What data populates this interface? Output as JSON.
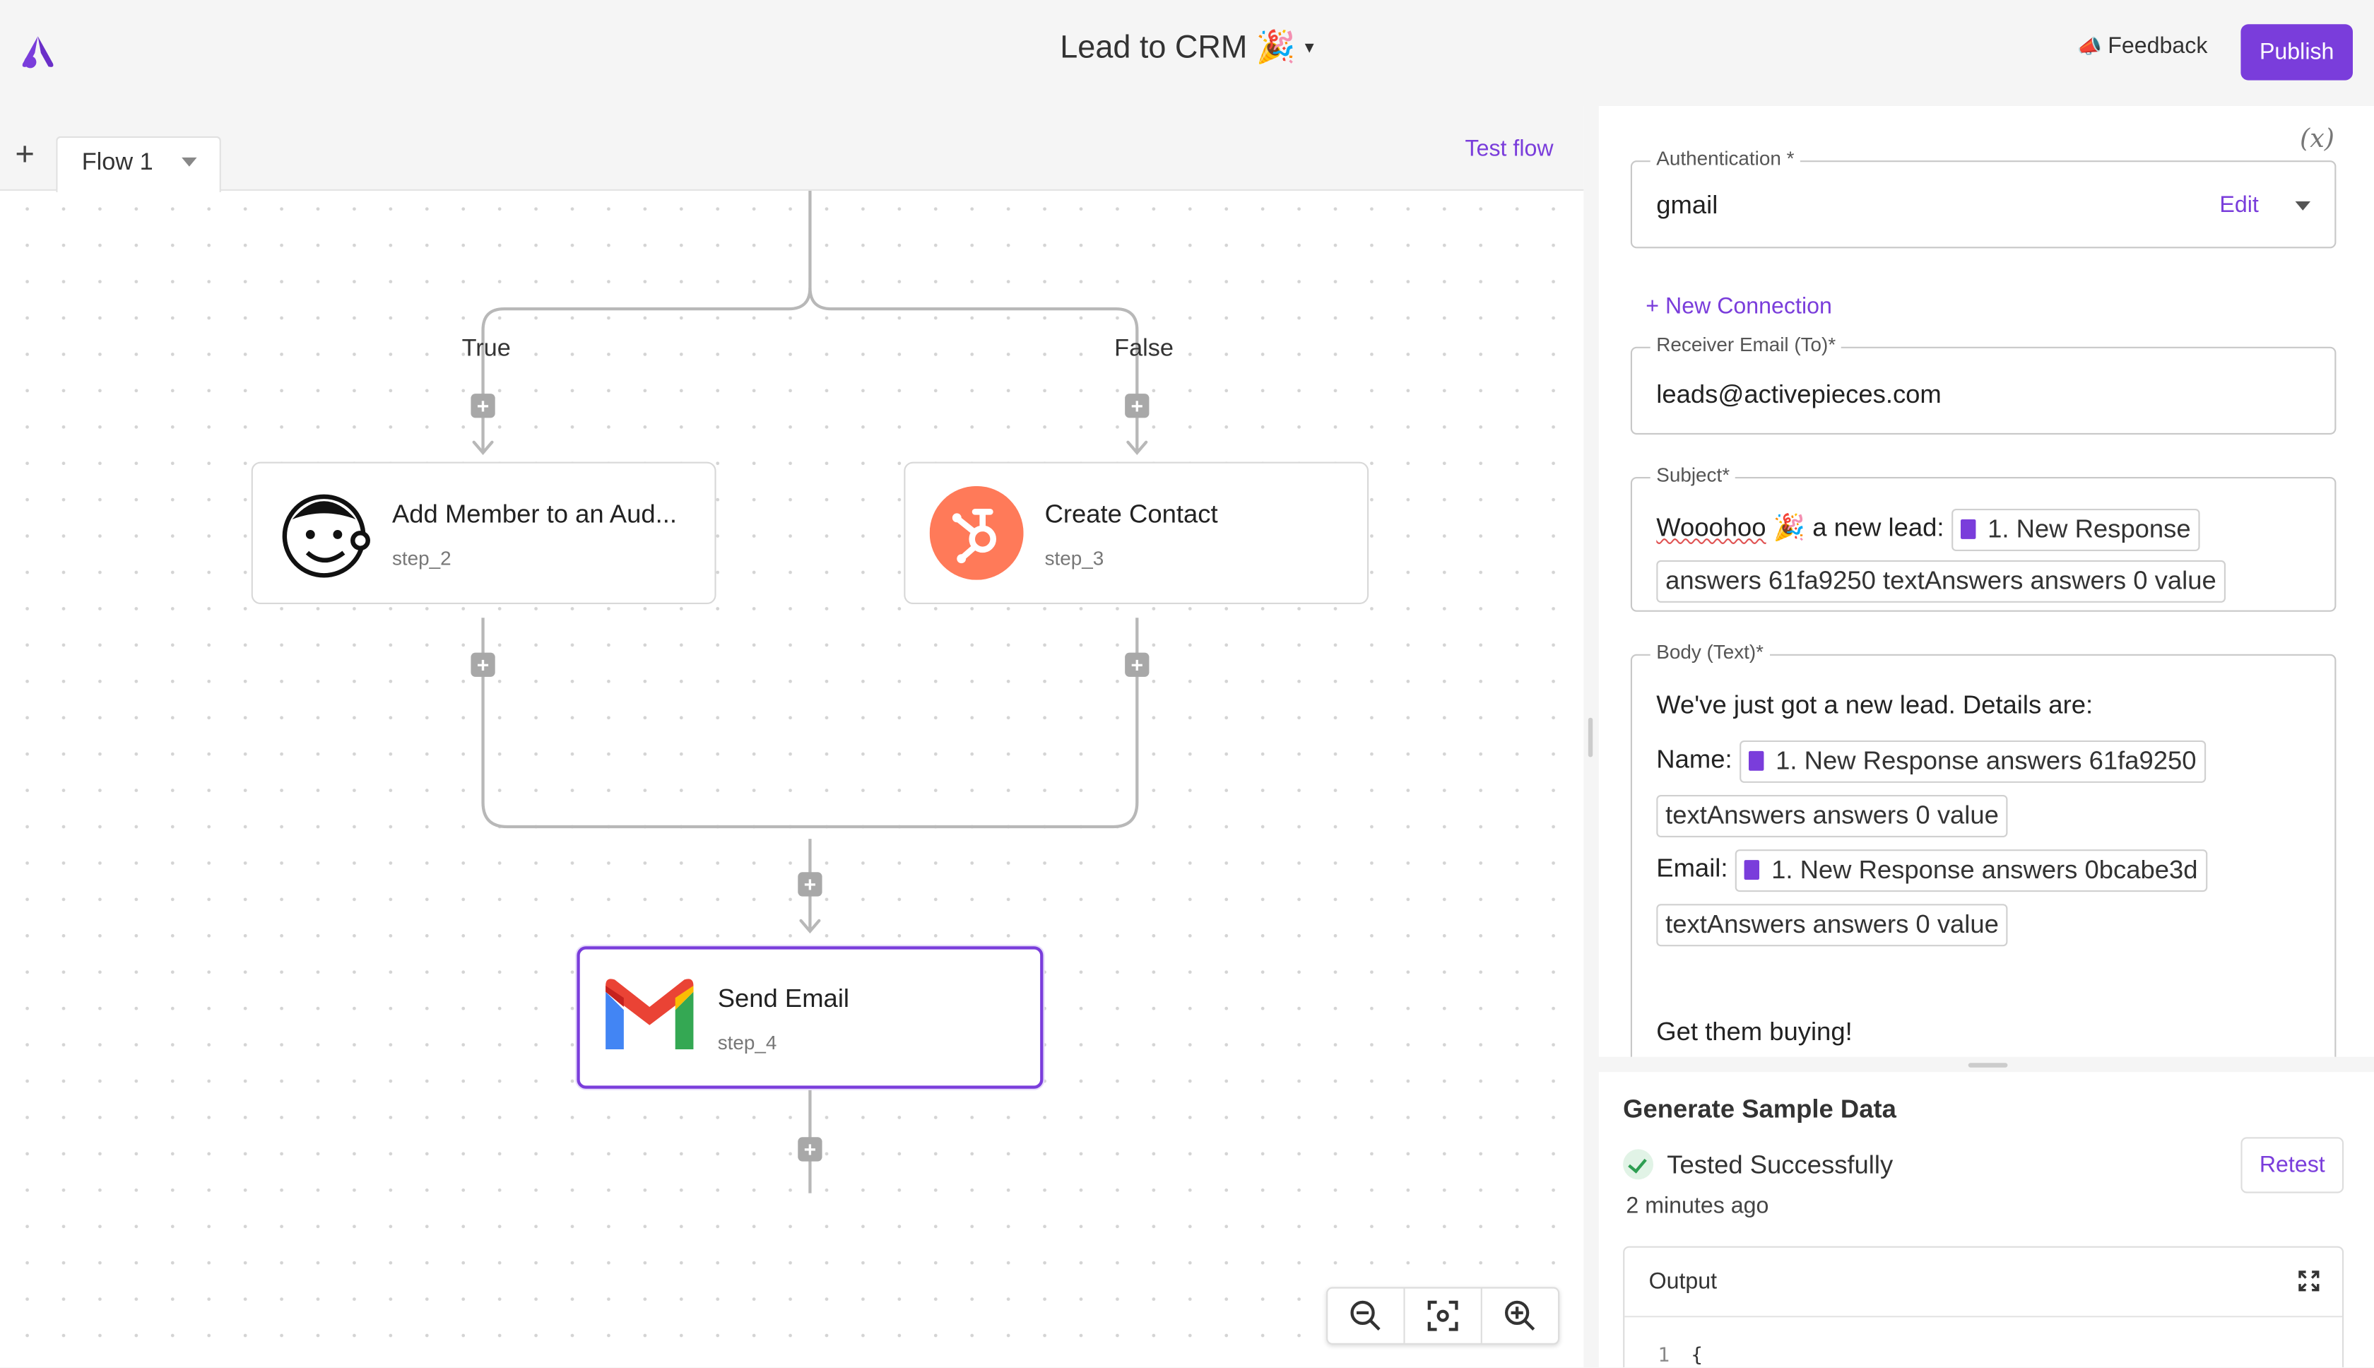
{
  "header": {
    "flow_name": "Lead to CRM 🎉",
    "feedback_label": "Feedback",
    "publish_label": "Publish"
  },
  "canvas": {
    "flow_tab": "Flow 1",
    "test_flow_label": "Test flow",
    "branches": {
      "true_label": "True",
      "false_label": "False"
    },
    "nodes": [
      {
        "title": "Add Member to an Aud...",
        "step": "step_2",
        "icon": "mailchimp-icon"
      },
      {
        "title": "Create Contact",
        "step": "step_3",
        "icon": "hubspot-icon"
      },
      {
        "title": "Send Email",
        "step": "step_4",
        "icon": "gmail-icon"
      }
    ]
  },
  "settings": {
    "auth": {
      "label": "Authentication *",
      "value": "gmail",
      "edit_label": "Edit"
    },
    "new_connection_label": "+ New Connection",
    "receiver": {
      "label": "Receiver Email (To)*",
      "value": "leads@activepieces.com"
    },
    "subject": {
      "label": "Subject*",
      "text_a": "Wooohoo",
      "text_b": "🎉 a new lead:",
      "chip_a": "1. New Response",
      "chip_b": "answers 61fa9250 textAnswers answers 0 value"
    },
    "body": {
      "label": "Body (Text)*",
      "line1": "We've just got a new lead. Details are:",
      "name_label": "Name:",
      "name_chip_a": "1. New Response answers 61fa9250",
      "name_chip_b": "textAnswers answers 0 value",
      "email_label": "Email:",
      "email_chip_a": "1. New Response answers 0bcabe3d",
      "email_chip_b": "textAnswers answers 0 value",
      "closing": "Get them buying!"
    }
  },
  "sample": {
    "title": "Generate Sample Data",
    "status": "Tested Successfully",
    "time_ago": "2 minutes ago",
    "retest_label": "Retest",
    "output_label": "Output",
    "code_line_no": "1",
    "code_first": "{"
  },
  "colors": {
    "accent": "#7a3ddb",
    "hubspot": "#ff7a59",
    "success": "#2e9e52"
  }
}
